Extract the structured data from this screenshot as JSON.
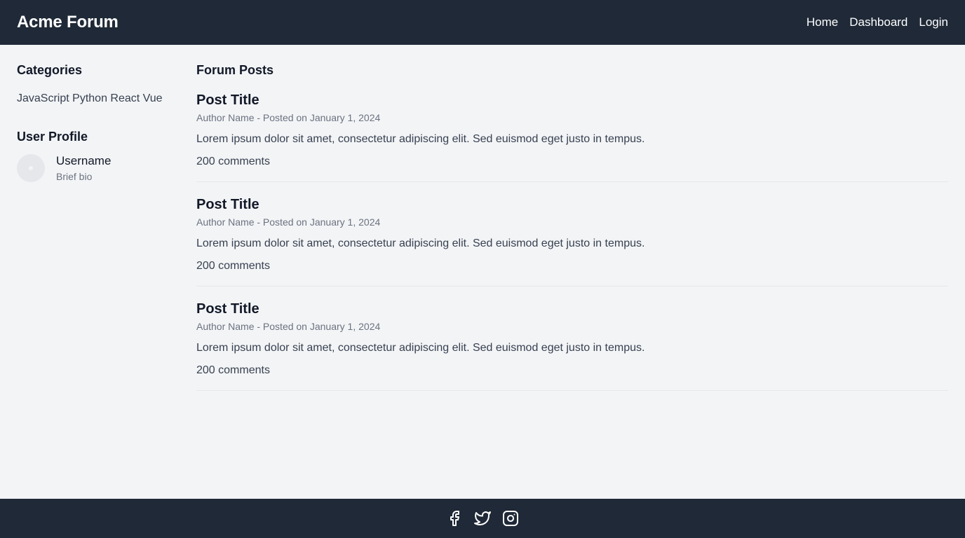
{
  "header": {
    "brand": "Acme Forum",
    "nav": [
      {
        "label": "Home"
      },
      {
        "label": "Dashboard"
      },
      {
        "label": "Login"
      }
    ]
  },
  "sidebar": {
    "categories_heading": "Categories",
    "categories": [
      "JavaScript",
      "Python",
      "React",
      "Vue"
    ],
    "profile_heading": "User Profile",
    "profile": {
      "username": "Username",
      "bio": "Brief bio"
    }
  },
  "main": {
    "heading": "Forum Posts",
    "posts": [
      {
        "title": "Post Title",
        "meta": "Author Name - Posted on January 1, 2024",
        "body": "Lorem ipsum dolor sit amet, consectetur adipiscing elit. Sed euismod eget justo in tempus.",
        "comments": "200 comments"
      },
      {
        "title": "Post Title",
        "meta": "Author Name - Posted on January 1, 2024",
        "body": "Lorem ipsum dolor sit amet, consectetur adipiscing elit. Sed euismod eget justo in tempus.",
        "comments": "200 comments"
      },
      {
        "title": "Post Title",
        "meta": "Author Name - Posted on January 1, 2024",
        "body": "Lorem ipsum dolor sit amet, consectetur adipiscing elit. Sed euismod eget justo in tempus.",
        "comments": "200 comments"
      }
    ]
  },
  "footer": {
    "icons": [
      "facebook-icon",
      "twitter-icon",
      "instagram-icon"
    ]
  },
  "colors": {
    "header_bg": "#1f2937",
    "page_bg": "#f3f4f6",
    "text_primary": "#111827",
    "text_muted": "#6b7280"
  }
}
